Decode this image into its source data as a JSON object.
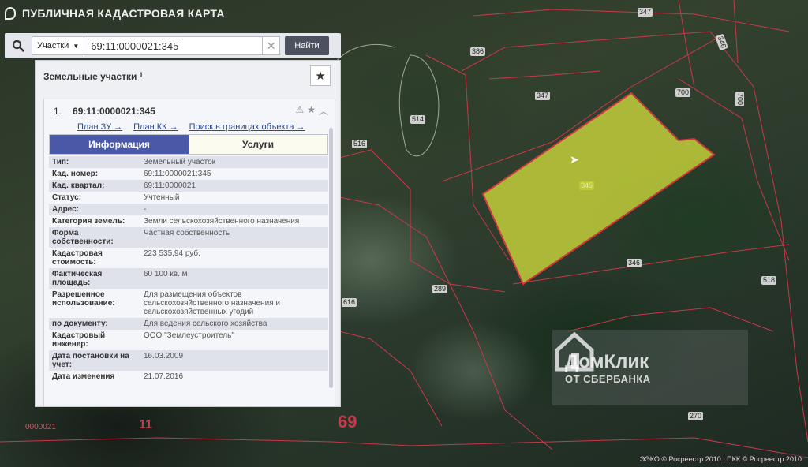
{
  "app": {
    "title": "ПУБЛИЧНАЯ КАДАСТРОВАЯ КАРТА"
  },
  "search": {
    "scope_label": "Участки",
    "query": "69:11:0000021:345",
    "find_label": "Найти"
  },
  "panel": {
    "title": "Земельные участки",
    "count": "1",
    "result": {
      "index": "1.",
      "cadastral_id": "69:11:0000021:345",
      "links": [
        "План ЗУ →",
        "План КК →",
        "Поиск в границах объекта →"
      ],
      "tabs": {
        "info": "Информация",
        "services": "Услуги"
      },
      "rows": [
        {
          "key": "Тип:",
          "value": "Земельный участок"
        },
        {
          "key": "Кад. номер:",
          "value": "69:11:0000021:345"
        },
        {
          "key": "Кад. квартал:",
          "value": "69:11:0000021"
        },
        {
          "key": "Статус:",
          "value": "Учтенный"
        },
        {
          "key": "Адрес:",
          "value": "-"
        },
        {
          "key": "Категория земель:",
          "value": "Земли сельскохозяйственного назначения"
        },
        {
          "key": "Форма собственности:",
          "value": "Частная собственность"
        },
        {
          "key": "Кадастровая стоимость:",
          "value": "223 535,94 руб."
        },
        {
          "key": "Фактическая площадь:",
          "value": "60 100 кв. м"
        },
        {
          "key": "Разрешенное использование:",
          "value": "Для размещения объектов сельскохозяйственного назначения и сельскохозяйственных угодий"
        },
        {
          "key": "по документу:",
          "value": "Для ведения сельского хозяйства"
        },
        {
          "key": "Кадастровый инженер:",
          "value": "ООО \"Землеустроитель\""
        },
        {
          "key": "Дата постановки на учет:",
          "value": "16.03.2009"
        },
        {
          "key": "Дата изменения",
          "value": "21.07.2016"
        }
      ]
    }
  },
  "map": {
    "highlight_color": "#c8d43a",
    "boundary_color": "#c7394a",
    "parcel_labels": [
      "347",
      "386",
      "346",
      "700",
      "700",
      "347",
      "514",
      "516",
      "345",
      "346",
      "289",
      "518",
      "616",
      "270"
    ],
    "region_number": "69",
    "grid_number": "11",
    "quarter_label": "0000021",
    "copyright": "ЭЭКО © Росреестр 2010 | ПКК © Росреестр 2010"
  },
  "watermark": {
    "brand": "ДомКлик",
    "sub": "ОТ СБЕРБАНКА"
  }
}
